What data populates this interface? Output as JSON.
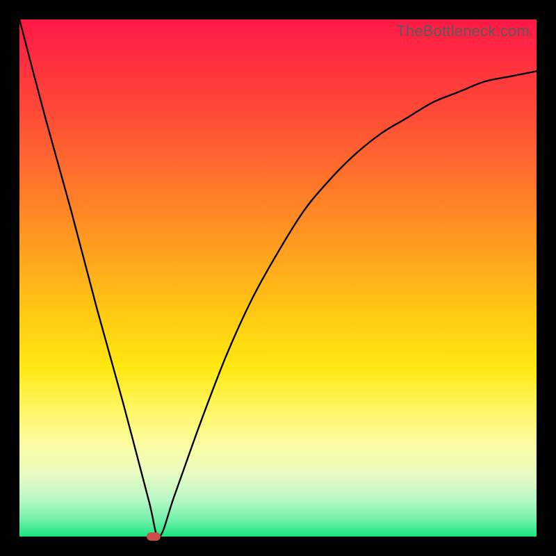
{
  "watermark": "TheBottleneck.com",
  "chart_data": {
    "type": "line",
    "title": "",
    "xlabel": "",
    "ylabel": "",
    "xlim": [
      0,
      100
    ],
    "ylim": [
      0,
      100
    ],
    "grid": false,
    "legend": false,
    "annotations": [],
    "series": [
      {
        "name": "bottleneck-curve",
        "x": [
          0,
          5,
          10,
          15,
          20,
          25,
          27,
          30,
          35,
          40,
          45,
          50,
          55,
          60,
          65,
          70,
          75,
          80,
          85,
          90,
          95,
          100
        ],
        "y": [
          100,
          81,
          63,
          44,
          26,
          7,
          0,
          8,
          22,
          35,
          46,
          55,
          63,
          69,
          74,
          78,
          81,
          84,
          86,
          88,
          89,
          90
        ]
      }
    ],
    "marker": {
      "x": 26,
      "y": 0,
      "color": "#c94f4b"
    },
    "background_gradient": {
      "top": "#ff1846",
      "mid": "#ffd012",
      "bottom": "#17e67f"
    }
  }
}
